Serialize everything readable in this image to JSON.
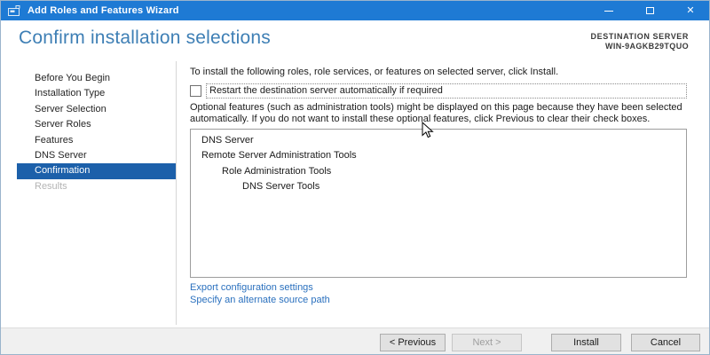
{
  "window": {
    "title": "Add Roles and Features Wizard"
  },
  "header": {
    "title": "Confirm installation selections",
    "destination_label": "DESTINATION SERVER",
    "destination_server": "WIN-9AGKB29TQUO"
  },
  "sidebar": {
    "items": [
      {
        "label": "Before You Begin",
        "state": "normal"
      },
      {
        "label": "Installation Type",
        "state": "normal"
      },
      {
        "label": "Server Selection",
        "state": "normal"
      },
      {
        "label": "Server Roles",
        "state": "normal"
      },
      {
        "label": "Features",
        "state": "normal"
      },
      {
        "label": "DNS Server",
        "state": "normal"
      },
      {
        "label": "Confirmation",
        "state": "selected"
      },
      {
        "label": "Results",
        "state": "disabled"
      }
    ]
  },
  "content": {
    "intro": "To install the following roles, role services, or features on selected server, click Install.",
    "restart_checkbox": {
      "label": "Restart the destination server automatically if required",
      "checked": false
    },
    "optional_note": "Optional features (such as administration tools) might be displayed on this page because they have been selected automatically. If you do not want to install these optional features, click Previous to clear their check boxes.",
    "selection_list": [
      {
        "label": "DNS Server",
        "indent": 0
      },
      {
        "label": "Remote Server Administration Tools",
        "indent": 0
      },
      {
        "label": "Role Administration Tools",
        "indent": 1
      },
      {
        "label": "DNS Server Tools",
        "indent": 2
      }
    ],
    "links": [
      "Export configuration settings",
      "Specify an alternate source path"
    ]
  },
  "footer": {
    "buttons": [
      {
        "label": "< Previous",
        "state": "enabled"
      },
      {
        "label": "Next >",
        "state": "disabled"
      },
      {
        "label": "Install",
        "state": "enabled"
      },
      {
        "label": "Cancel",
        "state": "enabled"
      }
    ]
  },
  "colors": {
    "titlebar": "#1e7ad4",
    "header_title": "#3e7fb5",
    "sidebar_selected_bg": "#1c60aa",
    "link": "#2a70be",
    "footer_bg": "#f0f0f0"
  }
}
